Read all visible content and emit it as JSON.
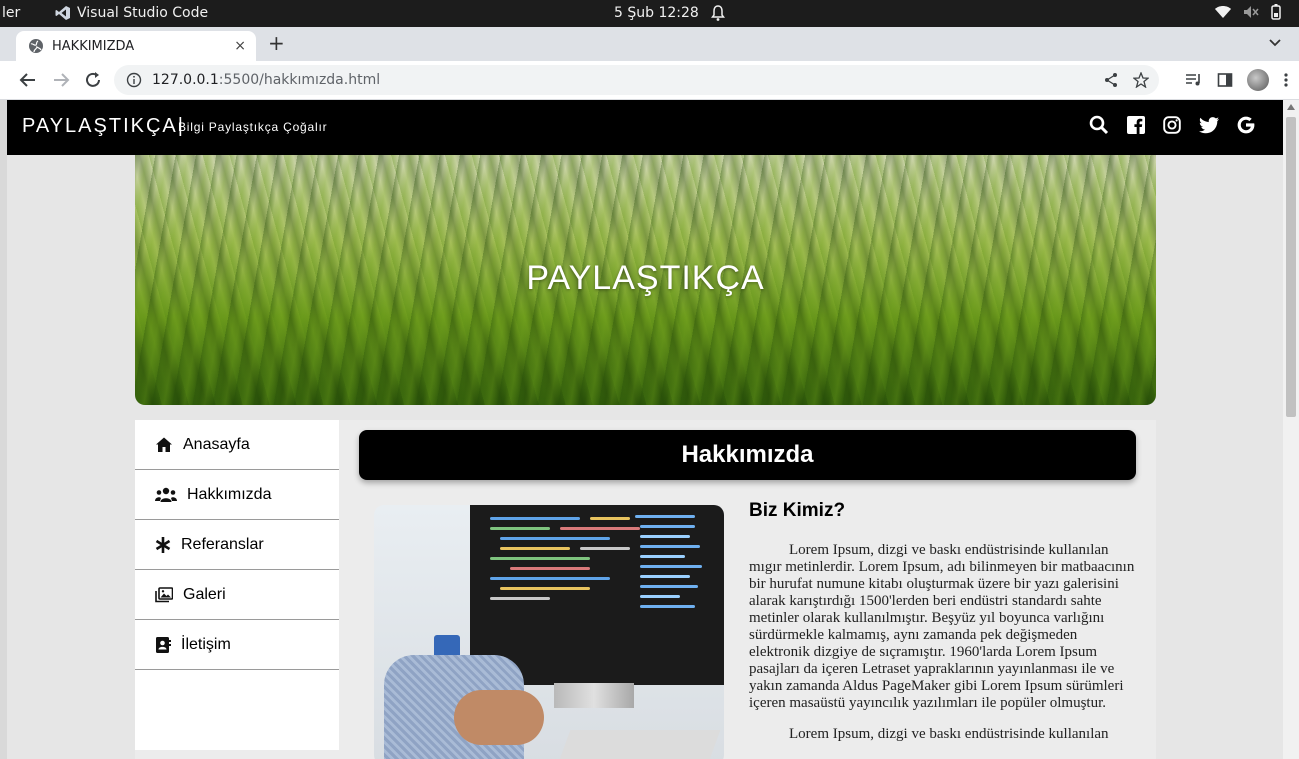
{
  "os": {
    "left_text": "ler",
    "app_name": "Visual Studio Code",
    "clock": "5 Şub  12:28"
  },
  "browser": {
    "tab_title": "HAKKIMIZDA",
    "tab_close": "×",
    "new_tab": "+",
    "url_host": "127.0.0.1",
    "url_path": ":5500/hakkımızda.html"
  },
  "site": {
    "brand": "PAYLAŞTIKÇA|",
    "tagline": "Bilgi Paylaştıkça Çoğalır",
    "social_icons": [
      "search-icon",
      "facebook-icon",
      "instagram-icon",
      "twitter-icon",
      "google-icon"
    ],
    "hero_title": "PAYLAŞTIKÇA",
    "sidebar": [
      {
        "label": "Anasayfa",
        "icon": "home-icon"
      },
      {
        "label": "Hakkımızda",
        "icon": "users-icon"
      },
      {
        "label": "Referanslar",
        "icon": "asterisk-icon"
      },
      {
        "label": "Galeri",
        "icon": "images-icon"
      },
      {
        "label": "İletişim",
        "icon": "contact-book-icon"
      }
    ],
    "section_title": "Hakkımızda",
    "article": {
      "heading": "Biz Kimiz?",
      "p1": "Lorem Ipsum, dizgi ve baskı endüstrisinde kullanılan mıgır metinlerdir. Lorem Ipsum, adı bilinmeyen bir matbaacının bir hurufat numune kitabı oluşturmak üzere bir yazı galerisini alarak karıştırdığı 1500'lerden beri endüstri standardı sahte metinler olarak kullanılmıştır. Beşyüz yıl boyunca varlığını sürdürmekle kalmamış, aynı zamanda pek değişmeden elektronik dizgiye de sıçramıştır. 1960'larda Lorem Ipsum pasajları da içeren Letraset yapraklarının yayınlanması ile ve yakın zamanda Aldus PageMaker gibi Lorem Ipsum sürümleri içeren masaüstü yayıncılık yazılımları ile popüler olmuştur.",
      "p2": "Lorem Ipsum, dizgi ve baskı endüstrisinde kullanılan"
    }
  }
}
